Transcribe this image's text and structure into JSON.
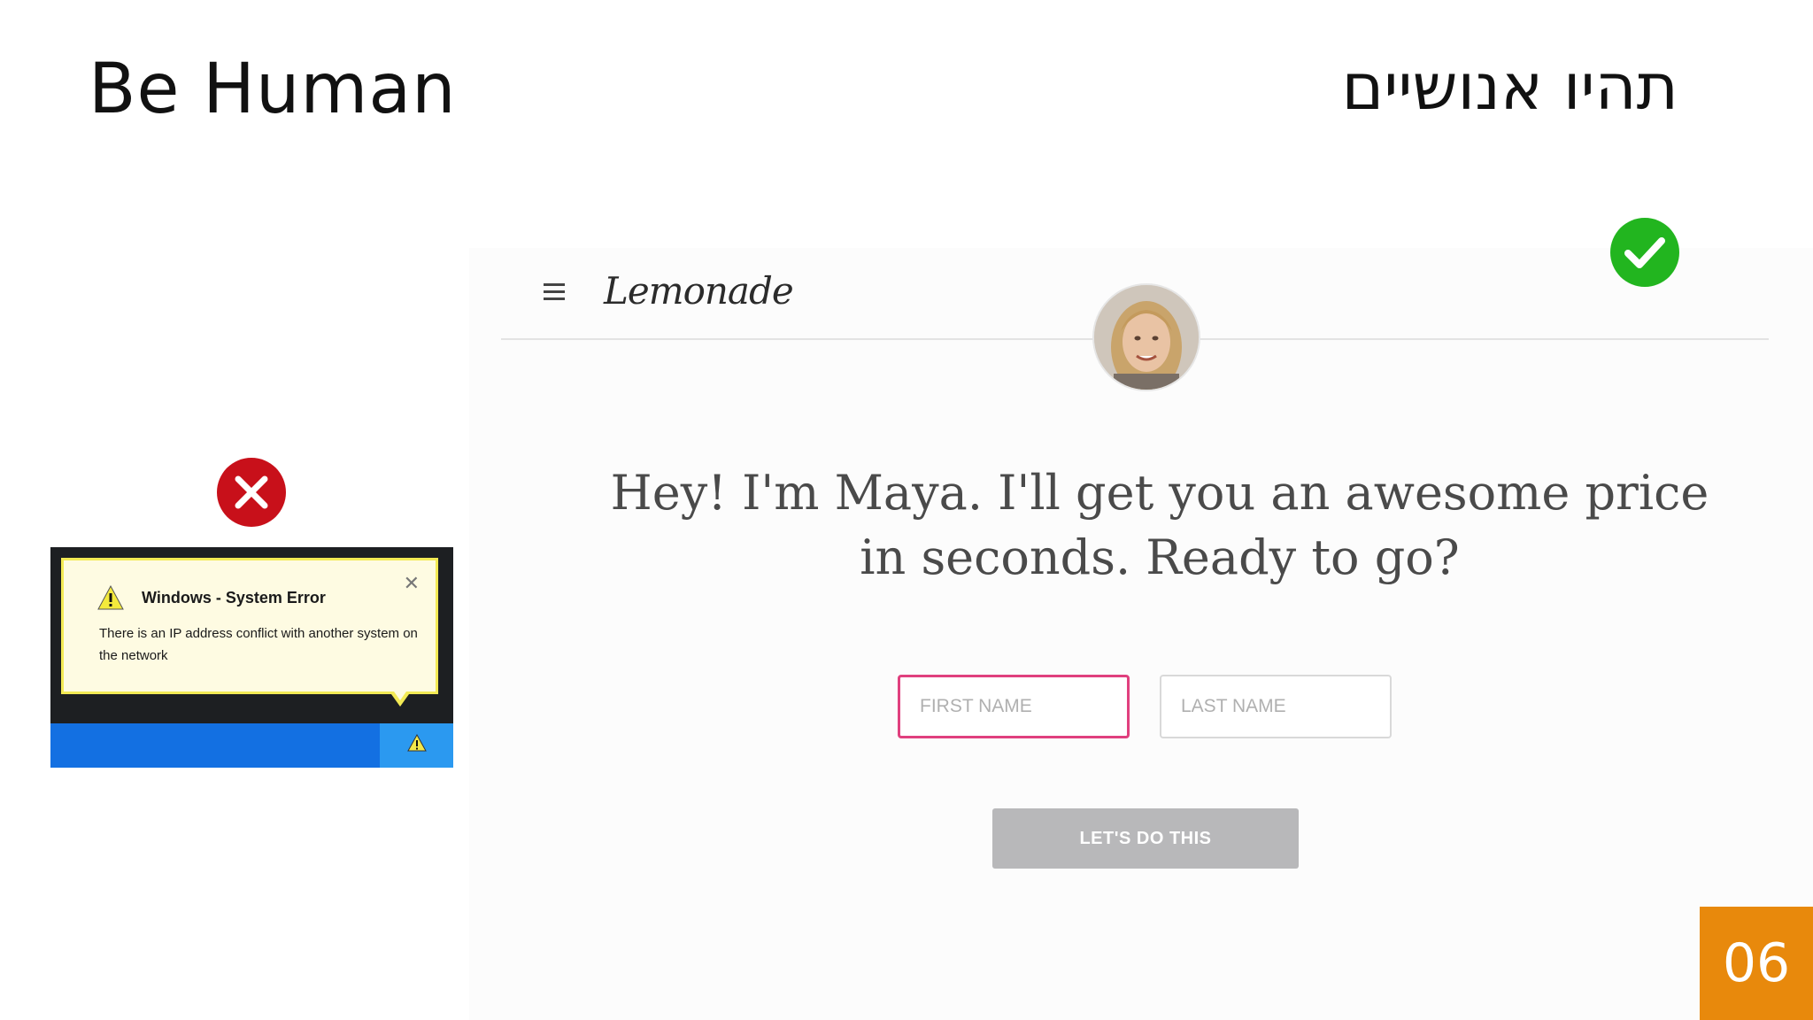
{
  "slide": {
    "title_en": "Be Human",
    "title_he": "תהיו אנושיים",
    "page_number": "06"
  },
  "lemonade": {
    "logo": "Lemonade",
    "message": "Hey! I'm Maya. I'll get you an awesome price in seconds. Ready to go?",
    "first_name_placeholder": "FIRST NAME",
    "last_name_placeholder": "LAST NAME",
    "cta_label": "LET'S DO THIS",
    "accent_color": "#e0407e",
    "status_icon": "green-check-icon"
  },
  "windows_error": {
    "title": "Windows - System Error",
    "body": "There is an IP address conflict with another system on the network",
    "close_glyph": "✕",
    "status_icon": "red-x-icon"
  },
  "colors": {
    "ok": "#22b51f",
    "bad": "#c8101a",
    "page_badge": "#e8890c",
    "taskbar": "#1370e2"
  }
}
